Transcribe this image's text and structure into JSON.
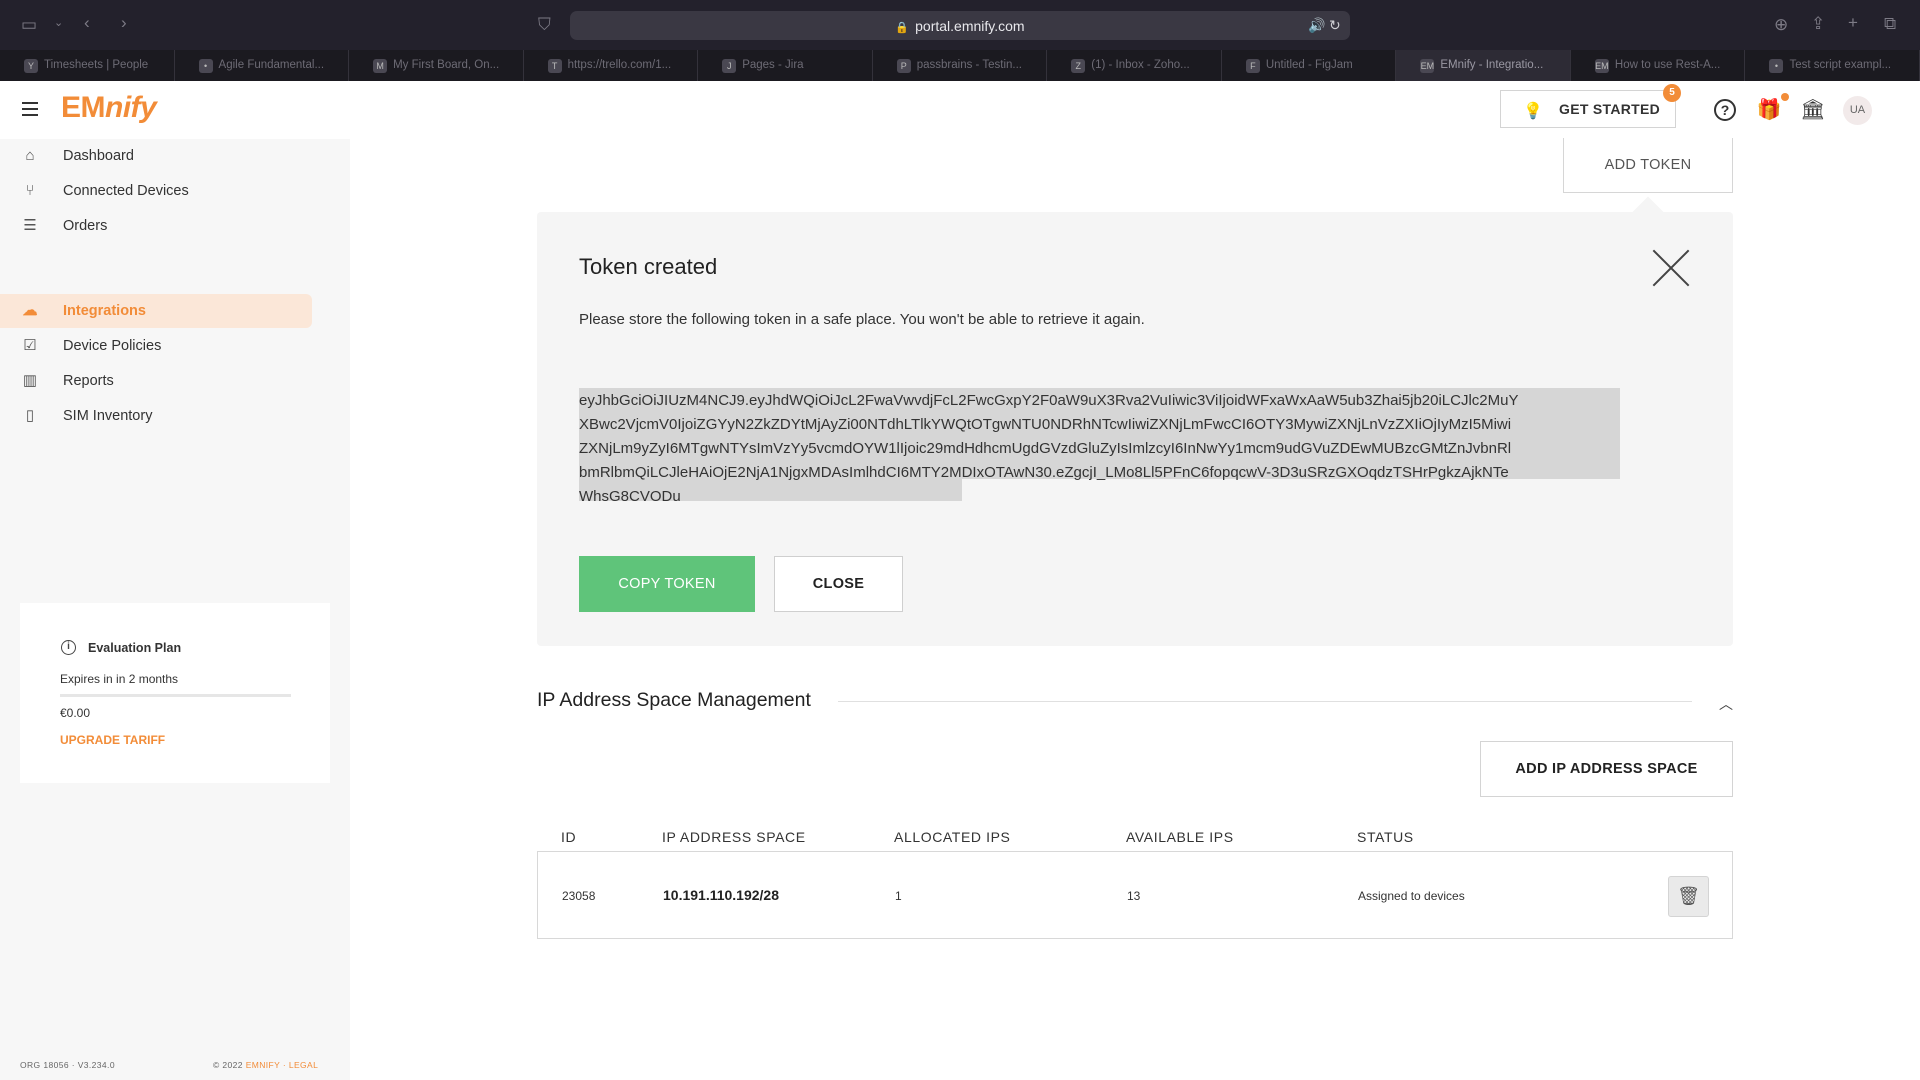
{
  "browser": {
    "url": "portal.emnify.com",
    "tabs": [
      {
        "label": "Timesheets | People",
        "icon": "Y"
      },
      {
        "label": "Agile Fundamental...",
        "icon": "•"
      },
      {
        "label": "My First Board, On...",
        "icon": "M"
      },
      {
        "label": "https://trello.com/1...",
        "icon": "T"
      },
      {
        "label": "Pages - Jira",
        "icon": "J"
      },
      {
        "label": "passbrains - Testin...",
        "icon": "P"
      },
      {
        "label": "(1) - Inbox - Zoho...",
        "icon": "Z"
      },
      {
        "label": "Untitled - FigJam",
        "icon": "F"
      },
      {
        "label": "EMnify - Integratio...",
        "icon": "EM"
      },
      {
        "label": "How to use Rest-A...",
        "icon": "EM"
      },
      {
        "label": "Test script exampl...",
        "icon": "•"
      }
    ]
  },
  "header": {
    "logo_prefix": "EM",
    "logo_suffix": "nify",
    "get_started": "GET STARTED",
    "badge_count": "5",
    "avatar_initials": "UA"
  },
  "sidebar": {
    "items": [
      {
        "label": "Dashboard",
        "icon": "home-icon"
      },
      {
        "label": "Connected Devices",
        "icon": "network-icon"
      },
      {
        "label": "Orders",
        "icon": "orders-icon"
      },
      {
        "label": "Integrations",
        "icon": "cloud-icon"
      },
      {
        "label": "Device Policies",
        "icon": "checkbox-icon"
      },
      {
        "label": "Reports",
        "icon": "chart-icon"
      },
      {
        "label": "SIM Inventory",
        "icon": "sim-icon"
      }
    ],
    "plan": {
      "title": "Evaluation Plan",
      "expires": "Expires in in 2 months",
      "price": "€0.00",
      "upgrade": "UPGRADE TARIFF"
    },
    "footer_left": "ORG 18056 · V3.234.0",
    "footer_copyright": "© 2022",
    "footer_brand": "EMNIFY",
    "footer_sep": "·",
    "footer_legal": "LEGAL"
  },
  "main": {
    "add_token": "ADD TOKEN",
    "token_panel": {
      "title": "Token created",
      "description": "Please store the following token in a safe place. You won't be able to retrieve it again.",
      "token": "eyJhbGciOiJIUzM4NCJ9.eyJhdWQiOiJcL2FwaVwvdjFcL2FwcGxpY2F0aW9uX3Rva2VuIiwic3ViIjoidWFxaWxAaW5ub3Zhai5jb20iLCJlc2MuYXBwc2VjcmV0IjoiZGYyN2ZkZDYtMjAyZi00NTdhLTlkYWQtOTgwNTU0NDRhNTcwIiwiZXNjLmFwcCI6OTY3MywiZXNjLnVzZXIiOjIyMzI5MiwiZXNjLm9yZyI6MTgwNTYsImVzYy5vcmdOYW1lIjoic29mdHdhcmUgdGVzdGluZyIsImlzcyI6InNwYy1mcm9udGVuZDEwMUBzcGMtZnJvbnRlbmRlbmQiLCJleHAiOjE2NjA1NjgxMDAsImlhdCI6MTY2MDIxOTAwN30.eZgcjI_LMo8Ll5PFnC6fopqcwV-3D3uSRzGXOqdzTSHrPgkzAjkNTeWhsG8CVODu",
      "copy_label": "COPY TOKEN",
      "close_label": "CLOSE"
    },
    "ip_section": {
      "title": "IP Address Space Management",
      "add_label": "ADD IP ADDRESS SPACE",
      "columns": [
        "ID",
        "IP ADDRESS SPACE",
        "ALLOCATED IPS",
        "AVAILABLE IPS",
        "STATUS"
      ],
      "rows": [
        {
          "id": "23058",
          "ip_space": "10.191.110.192/28",
          "allocated": "1",
          "available": "13",
          "status": "Assigned to devices"
        }
      ]
    }
  }
}
